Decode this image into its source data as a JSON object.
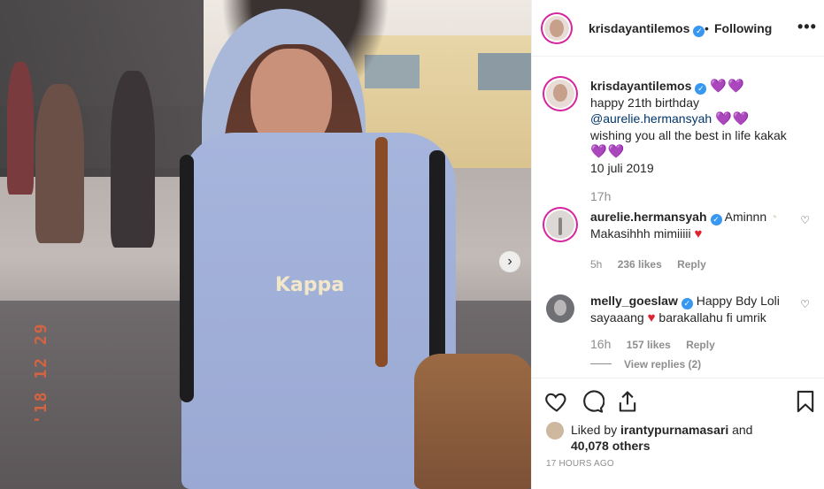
{
  "post": {
    "photo_stamp": "'18 12 29",
    "photo_logo": "Kappa"
  },
  "header": {
    "username": "krisdayantilemos",
    "separator": "•",
    "follow_status": "Following",
    "more": "•••"
  },
  "caption": {
    "username": "krisdayantilemos",
    "hearts1": "💜💜",
    "line1": "happy 21th birthday",
    "mention": "@aurelie.hermansyah",
    "hearts2": "💜💜",
    "line3": "wishing you all the best in life kakak",
    "hearts3": "💜💜",
    "line4": "10 juli 2019",
    "time": "17h"
  },
  "comments": [
    {
      "username": "aurelie.hermansyah",
      "text_a": "Aminnn",
      "text_b": "Makasihhh mimiiiii",
      "time": "5h",
      "likes": "236 likes",
      "reply": "Reply"
    },
    {
      "username": "melly_goeslaw",
      "text_a": "Happy Bdy Loli",
      "text_b": "sayaaang",
      "text_c": "barakallahu fi umrik",
      "time": "16h",
      "likes": "157 likes",
      "reply": "Reply",
      "view_replies": "View replies (2)"
    }
  ],
  "footer": {
    "liked_by_prefix": "Liked by",
    "liked_by_user": "irantypurnamasari",
    "and": "and",
    "others": "40,078 others",
    "time_ago": "17 HOURS AGO"
  },
  "colors": {
    "verified": "#3897f0",
    "heart_purple": "#7b4fd8",
    "heart_red": "#e0212f",
    "muted": "#8e8e8e",
    "story_ring": "#d6249f"
  },
  "icons": {
    "like": "heart-outline-icon",
    "comment": "comment-bubble-icon",
    "share": "share-arrow-icon",
    "save": "bookmark-icon",
    "next": "chevron-right-icon",
    "verified": "verified-badge-icon"
  }
}
